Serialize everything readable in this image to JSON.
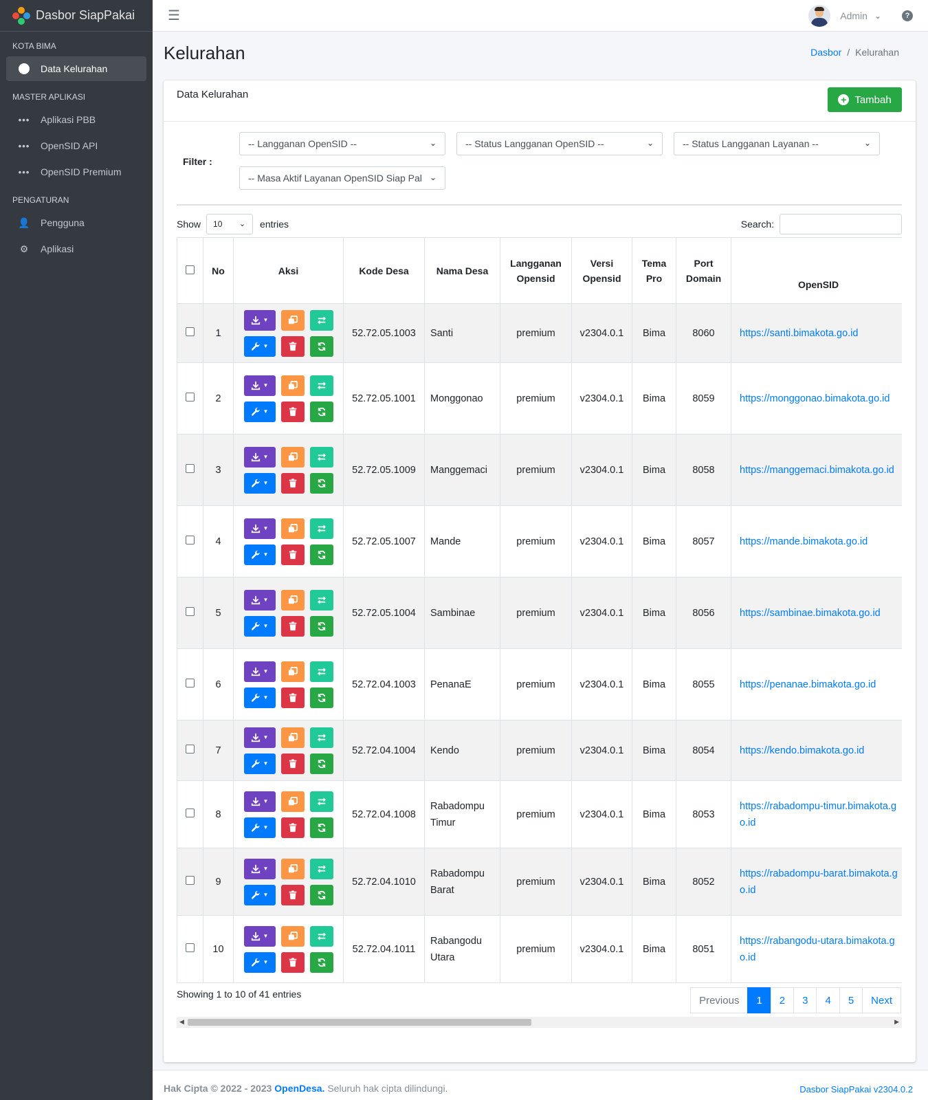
{
  "brand": {
    "title": "Dasbor SiapPakai"
  },
  "navbar": {
    "user_name": "Admin",
    "help_icon_label": "?"
  },
  "sidebar": {
    "sections": [
      {
        "header": "KOTA BIMA",
        "items": [
          {
            "label": "Data Kelurahan",
            "icon": "circle-icon",
            "active": true
          }
        ]
      },
      {
        "header": "MASTER APLIKASI",
        "items": [
          {
            "label": "Aplikasi PBB",
            "icon": "dots-icon"
          },
          {
            "label": "OpenSID API",
            "icon": "dots-icon"
          },
          {
            "label": "OpenSID Premium",
            "icon": "dots-icon"
          }
        ]
      },
      {
        "header": "PENGATURAN",
        "items": [
          {
            "label": "Pengguna",
            "icon": "user-icon"
          },
          {
            "label": "Aplikasi",
            "icon": "gear-icon"
          }
        ]
      }
    ]
  },
  "page": {
    "title": "Kelurahan"
  },
  "breadcrumb": {
    "home": "Dasbor",
    "current": "Kelurahan",
    "separator": "/"
  },
  "card": {
    "title": "Data Kelurahan",
    "add_button": "Tambah"
  },
  "filter": {
    "label": "Filter :",
    "selects": [
      "-- Langganan OpenSID --",
      "-- Status Langganan OpenSID --",
      "-- Status Langganan Layanan --",
      "-- Masa Aktif Layanan OpenSID Siap Pakai --"
    ]
  },
  "table_controls": {
    "show": "Show",
    "entries_value": "10",
    "entries": "entries",
    "search_label": "Search:",
    "search_value": ""
  },
  "table": {
    "headers": {
      "no": "No",
      "aksi": "Aksi",
      "kode": "Kode Desa",
      "nama": "Nama Desa",
      "langganan": "Langganan Opensid",
      "versi": "Versi Opensid",
      "tema": "Tema Pro",
      "port": "Port Domain",
      "opensid": "OpenSID"
    },
    "rows": [
      {
        "no": "1",
        "kode": "52.72.05.1003",
        "nama": "Santi",
        "langganan": "premium",
        "versi": "v2304.0.1",
        "tema": "Bima",
        "port": "8060",
        "url": "https://santi.bimakota.go.id"
      },
      {
        "no": "2",
        "kode": "52.72.05.1001",
        "nama": "Monggonao",
        "langganan": "premium",
        "versi": "v2304.0.1",
        "tema": "Bima",
        "port": "8059",
        "url": "https://monggonao.bimakota.go.id"
      },
      {
        "no": "3",
        "kode": "52.72.05.1009",
        "nama": "Manggemaci",
        "langganan": "premium",
        "versi": "v2304.0.1",
        "tema": "Bima",
        "port": "8058",
        "url": "https://manggemaci.bimakota.go.id"
      },
      {
        "no": "4",
        "kode": "52.72.05.1007",
        "nama": "Mande",
        "langganan": "premium",
        "versi": "v2304.0.1",
        "tema": "Bima",
        "port": "8057",
        "url": "https://mande.bimakota.go.id"
      },
      {
        "no": "5",
        "kode": "52.72.05.1004",
        "nama": "Sambinae",
        "langganan": "premium",
        "versi": "v2304.0.1",
        "tema": "Bima",
        "port": "8056",
        "url": "https://sambinae.bimakota.go.id"
      },
      {
        "no": "6",
        "kode": "52.72.04.1003",
        "nama": "PenanaE",
        "langganan": "premium",
        "versi": "v2304.0.1",
        "tema": "Bima",
        "port": "8055",
        "url": "https://penanae.bimakota.go.id"
      },
      {
        "no": "7",
        "kode": "52.72.04.1004",
        "nama": "Kendo",
        "langganan": "premium",
        "versi": "v2304.0.1",
        "tema": "Bima",
        "port": "8054",
        "url": "https://kendo.bimakota.go.id"
      },
      {
        "no": "8",
        "kode": "52.72.04.1008",
        "nama": "Rabadompu Timur",
        "langganan": "premium",
        "versi": "v2304.0.1",
        "tema": "Bima",
        "port": "8053",
        "url": "https://rabadompu-timur.bimakota.go.id"
      },
      {
        "no": "9",
        "kode": "52.72.04.1010",
        "nama": "Rabadompu Barat",
        "langganan": "premium",
        "versi": "v2304.0.1",
        "tema": "Bima",
        "port": "8052",
        "url": "https://rabadompu-barat.bimakota.go.id"
      },
      {
        "no": "10",
        "kode": "52.72.04.1011",
        "nama": "Rabangodu Utara",
        "langganan": "premium",
        "versi": "v2304.0.1",
        "tema": "Bima",
        "port": "8051",
        "url": "https://rabangodu-utara.bimakota.go.id"
      }
    ]
  },
  "info": "Showing 1 to 10 of 41 entries",
  "pagination": {
    "previous": "Previous",
    "pages": [
      "1",
      "2",
      "3",
      "4",
      "5"
    ],
    "active": "1",
    "next": "Next"
  },
  "footer": {
    "copyright_prefix": "Hak Cipta © 2022 - 2023",
    "brand_link": "OpenDesa.",
    "rights": "Seluruh hak cipta dilindungi.",
    "version": "Dasbor SiapPakai v2304.0.2"
  },
  "colors": {
    "sidebar": "#343a40",
    "primary": "#007bff",
    "success": "#28a745",
    "purple": "#6f42c1",
    "orange": "#fd9644",
    "teal": "#20c997",
    "danger": "#dc3545"
  }
}
